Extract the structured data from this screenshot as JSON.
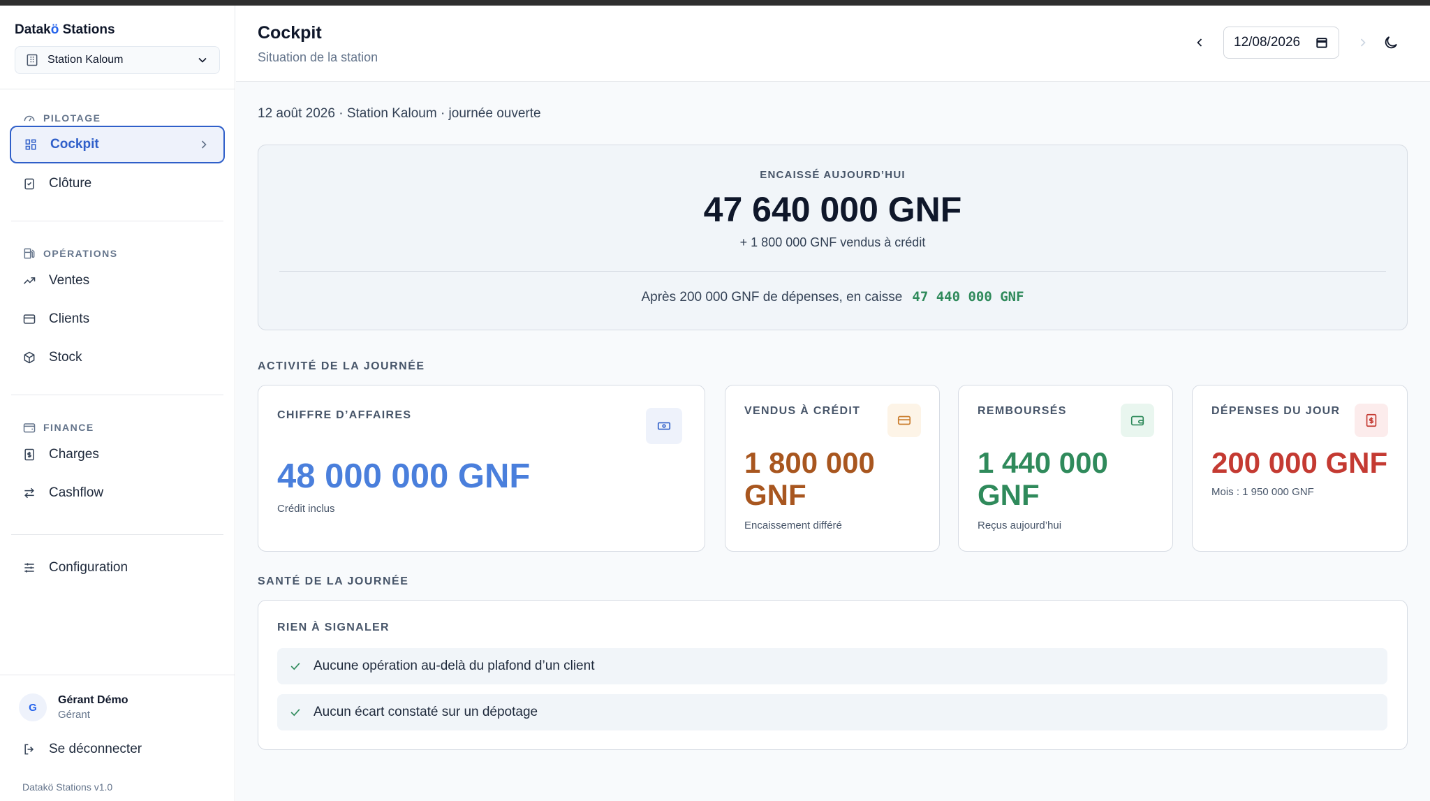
{
  "app": {
    "brand_prefix": "Datak",
    "brand_accent": "ö",
    "brand_suffix": " Stations",
    "version": "Datakö Stations v1.0"
  },
  "sidebar": {
    "station_selector": "Station Kaloum",
    "sections": {
      "pilotage": "PILOTAGE",
      "operations": "OPÉRATIONS",
      "finance": "FINANCE"
    },
    "items": {
      "cockpit": "Cockpit",
      "cloture": "Clôture",
      "ventes": "Ventes",
      "clients": "Clients",
      "stock": "Stock",
      "charges": "Charges",
      "cashflow": "Cashflow",
      "configuration": "Configuration"
    },
    "user": {
      "initial": "G",
      "name": "Gérant Démo",
      "role": "Gérant"
    },
    "logout": "Se déconnecter"
  },
  "header": {
    "title": "Cockpit",
    "subtitle": "Situation de la station",
    "date_value": "12/08/2026"
  },
  "main": {
    "day_meta": "12 août 2026 · Station Kaloum · journée ouverte",
    "hero": {
      "label": "ENCAISSÉ AUJOURD’HUI",
      "amount": "47 640 000 GNF",
      "credit_line": "+ 1 800 000 GNF vendus à crédit",
      "cash_line": "Après 200 000 GNF de dépenses, en caisse",
      "cash_amount": "47 440 000 GNF"
    },
    "activity_title": "ACTIVITÉ DE LA JOURNÉE",
    "cards": {
      "ca": {
        "label": "CHIFFRE D’AFFAIRES",
        "value": "48 000 000 GNF",
        "note": "Crédit inclus"
      },
      "credit": {
        "label": "VENDUS À CRÉDIT",
        "value_line1": "1 800 000",
        "value_line2": "GNF",
        "note": "Encaissement différé"
      },
      "rembourses": {
        "label": "REMBOURSÉS",
        "value_line1": "1 440 000",
        "value_line2": "GNF",
        "note": "Reçus aujourd’hui"
      },
      "depenses": {
        "label": "DÉPENSES DU JOUR",
        "value": "200 000 GNF",
        "note": "Mois : 1 950 000 GNF"
      }
    },
    "health_title": "SANTÉ DE LA JOURNÉE",
    "health": {
      "status": "RIEN À SIGNALER",
      "items": [
        "Aucune opération au-delà du plafond d’un client",
        "Aucun écart constaté sur un dépotage"
      ]
    }
  },
  "colors": {
    "accent": "#2f5fc9",
    "ca_blue": "#4a7fdc",
    "credit_brown": "#a8561f",
    "rembourse_green": "#2f8a5b",
    "depense_red": "#c43a32"
  }
}
